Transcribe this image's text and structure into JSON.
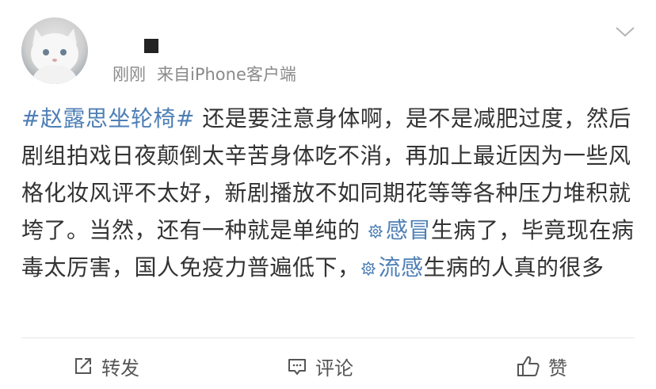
{
  "post": {
    "time": "刚刚",
    "source": "来自iPhone客户端",
    "hashtag": "#赵露思坐轮椅#",
    "text_part1": " 还是要注意身体啊，是不是减肥过度，然后剧组拍戏日夜颠倒太辛苦身体吃不消，再加上最近因为一些风格化妆风评不太好，新剧播放不如同期花等等各种压力堆积就垮了。当然，还有一种就是单纯的 ",
    "topic1": "感冒",
    "text_part2": "生病了，毕竟现在病毒太厉害，国人免疫力普遍低下，",
    "topic2": "流感",
    "text_part3": "生病的人真的很多"
  },
  "actions": {
    "forward_label": "转发",
    "comment_label": "评论",
    "like_label": "赞"
  },
  "icons": {
    "avatar": "white-cat-photo",
    "menu": "chevron-down-icon",
    "topic": "super-topic-icon",
    "forward": "forward-icon",
    "comment": "comment-icon",
    "like": "thumbs-up-icon"
  },
  "colors": {
    "link": "#4e7fb5",
    "meta": "#8a8a8a",
    "text": "#333333"
  }
}
